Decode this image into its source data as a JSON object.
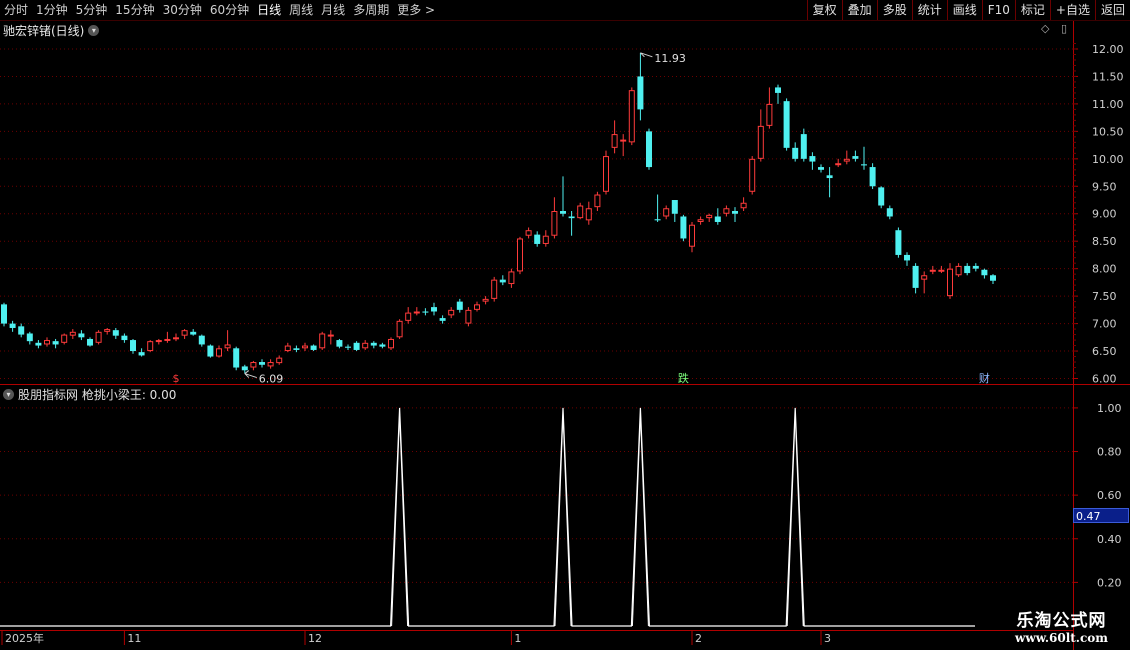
{
  "toolbar": {
    "tabs": [
      "分时",
      "1分钟",
      "5分钟",
      "15分钟",
      "30分钟",
      "60分钟",
      "日线",
      "周线",
      "月线",
      "多周期",
      "更多 >"
    ],
    "active_tab": "日线",
    "tools": [
      "复权",
      "叠加",
      "多股",
      "统计",
      "画线",
      "F10",
      "标记",
      "+自选",
      "返回"
    ]
  },
  "chart_title": {
    "name": "驰宏锌锗(日线)"
  },
  "indicator": {
    "title": "股朋指标网 枪挑小梁王: 0.00"
  },
  "cursor_value": "0.47",
  "brand": {
    "line1": "乐淘公式网",
    "line2": "www.60lt.com"
  },
  "colors": {
    "up": "#ff3b3b",
    "down": "#4ff0f0",
    "grid": "#6b0000",
    "bg": "#000000",
    "signal": "#ffffff"
  },
  "chart_data": [
    {
      "type": "candlestick",
      "ylim": [
        5.9,
        12.2
      ],
      "price_ticks": [
        "12.00",
        "11.50",
        "11.00",
        "10.50",
        "10.00",
        "9.50",
        "9.00",
        "8.50",
        "8.00",
        "7.50",
        "7.00",
        "6.50",
        "6.00"
      ],
      "annotations": {
        "high_label": "11.93",
        "low_label": "6.09"
      },
      "event_markers": [
        {
          "text": "$",
          "color": "#ff3b3b"
        },
        {
          "text": "跌",
          "color": "#7dff7d"
        },
        {
          "text": "财",
          "color": "#8fb8ff"
        }
      ],
      "x_labels": [
        "2025年",
        "11",
        "12",
        "1",
        "2",
        "3"
      ],
      "candles": [
        [
          7.35,
          7.0,
          7.38,
          6.95
        ],
        [
          7.0,
          6.92,
          7.05,
          6.85
        ],
        [
          6.95,
          6.8,
          7.0,
          6.75
        ],
        [
          6.82,
          6.68,
          6.85,
          6.62
        ],
        [
          6.65,
          6.6,
          6.7,
          6.55
        ],
        [
          6.62,
          6.7,
          6.75,
          6.58
        ],
        [
          6.68,
          6.62,
          6.72,
          6.55
        ],
        [
          6.65,
          6.8,
          6.82,
          6.62
        ],
        [
          6.78,
          6.85,
          6.9,
          6.72
        ],
        [
          6.82,
          6.75,
          6.88,
          6.7
        ],
        [
          6.72,
          6.6,
          6.75,
          6.58
        ],
        [
          6.65,
          6.85,
          6.88,
          6.62
        ],
        [
          6.85,
          6.9,
          6.92,
          6.8
        ],
        [
          6.88,
          6.78,
          6.92,
          6.72
        ],
        [
          6.78,
          6.7,
          6.82,
          6.65
        ],
        [
          6.7,
          6.5,
          6.72,
          6.45
        ],
        [
          6.48,
          6.42,
          6.55,
          6.4
        ],
        [
          6.5,
          6.68,
          6.7,
          6.48
        ],
        [
          6.68,
          6.7,
          6.72,
          6.62
        ],
        [
          6.7,
          6.72,
          6.85,
          6.65
        ],
        [
          6.72,
          6.75,
          6.82,
          6.68
        ],
        [
          6.78,
          6.88,
          6.9,
          6.72
        ],
        [
          6.85,
          6.8,
          6.9,
          6.78
        ],
        [
          6.78,
          6.62,
          6.8,
          6.58
        ],
        [
          6.6,
          6.4,
          6.62,
          6.38
        ],
        [
          6.4,
          6.55,
          6.6,
          6.38
        ],
        [
          6.55,
          6.62,
          6.88,
          6.5
        ],
        [
          6.55,
          6.2,
          6.58,
          6.15
        ],
        [
          6.22,
          6.15,
          6.25,
          6.09
        ],
        [
          6.2,
          6.3,
          6.32,
          6.15
        ],
        [
          6.3,
          6.25,
          6.35,
          6.2
        ],
        [
          6.22,
          6.3,
          6.35,
          6.18
        ],
        [
          6.28,
          6.38,
          6.42,
          6.25
        ],
        [
          6.5,
          6.6,
          6.65,
          6.48
        ],
        [
          6.55,
          6.52,
          6.6,
          6.48
        ],
        [
          6.55,
          6.6,
          6.65,
          6.5
        ],
        [
          6.6,
          6.52,
          6.62,
          6.5
        ],
        [
          6.55,
          6.82,
          6.85,
          6.52
        ],
        [
          6.78,
          6.8,
          6.88,
          6.62
        ],
        [
          6.7,
          6.58,
          6.72,
          6.55
        ],
        [
          6.58,
          6.56,
          6.62,
          6.52
        ],
        [
          6.65,
          6.52,
          6.68,
          6.5
        ],
        [
          6.55,
          6.65,
          6.7,
          6.52
        ],
        [
          6.65,
          6.6,
          6.68,
          6.55
        ],
        [
          6.62,
          6.58,
          6.65,
          6.55
        ],
        [
          6.55,
          6.72,
          6.75,
          6.52
        ],
        [
          6.75,
          7.05,
          7.08,
          6.72
        ],
        [
          7.05,
          7.2,
          7.3,
          7.0
        ],
        [
          7.22,
          7.22,
          7.3,
          7.15
        ],
        [
          7.22,
          7.2,
          7.28,
          7.15
        ],
        [
          7.3,
          7.22,
          7.38,
          7.15
        ],
        [
          7.1,
          7.05,
          7.15,
          7.0
        ],
        [
          7.15,
          7.25,
          7.3,
          7.1
        ],
        [
          7.4,
          7.25,
          7.45,
          7.2
        ],
        [
          7.0,
          7.25,
          7.3,
          6.95
        ],
        [
          7.25,
          7.35,
          7.4,
          7.22
        ],
        [
          7.4,
          7.45,
          7.5,
          7.35
        ],
        [
          7.45,
          7.8,
          7.85,
          7.4
        ],
        [
          7.8,
          7.75,
          7.88,
          7.7
        ],
        [
          7.72,
          7.95,
          8.0,
          7.65
        ],
        [
          7.95,
          8.55,
          8.58,
          7.9
        ],
        [
          8.6,
          8.7,
          8.75,
          8.55
        ],
        [
          8.62,
          8.45,
          8.68,
          8.4
        ],
        [
          8.45,
          8.6,
          8.7,
          8.4
        ],
        [
          8.6,
          9.05,
          9.3,
          8.55
        ],
        [
          9.05,
          9.0,
          9.68,
          8.95
        ],
        [
          8.95,
          8.92,
          9.05,
          8.6
        ],
        [
          8.92,
          9.15,
          9.2,
          8.9
        ],
        [
          8.88,
          9.1,
          9.22,
          8.8
        ],
        [
          9.12,
          9.35,
          9.4,
          9.05
        ],
        [
          9.4,
          10.05,
          10.15,
          9.35
        ],
        [
          10.2,
          10.45,
          10.7,
          10.1
        ],
        [
          10.35,
          10.35,
          10.45,
          10.05
        ],
        [
          10.3,
          11.25,
          11.3,
          10.25
        ],
        [
          11.5,
          10.9,
          11.93,
          10.7
        ],
        [
          10.5,
          9.85,
          10.55,
          9.8
        ],
        [
          8.9,
          8.88,
          9.35,
          8.85
        ],
        [
          8.95,
          9.1,
          9.15,
          8.9
        ],
        [
          9.25,
          9.0,
          9.25,
          8.85
        ],
        [
          8.95,
          8.55,
          8.98,
          8.5
        ],
        [
          8.4,
          8.8,
          8.85,
          8.3
        ],
        [
          8.85,
          8.9,
          8.95,
          8.8
        ],
        [
          8.92,
          8.98,
          9.0,
          8.85
        ],
        [
          8.95,
          8.85,
          9.1,
          8.8
        ],
        [
          9.0,
          9.1,
          9.15,
          8.95
        ],
        [
          9.05,
          9.0,
          9.12,
          8.85
        ],
        [
          9.1,
          9.2,
          9.3,
          9.05
        ],
        [
          9.4,
          10.0,
          10.05,
          9.35
        ],
        [
          10.0,
          10.6,
          10.9,
          9.95
        ],
        [
          10.6,
          11.0,
          11.3,
          10.55
        ],
        [
          11.3,
          11.2,
          11.35,
          11.0
        ],
        [
          11.05,
          10.2,
          11.1,
          10.15
        ],
        [
          10.2,
          10.0,
          10.3,
          9.95
        ],
        [
          10.45,
          10.0,
          10.55,
          9.95
        ],
        [
          10.05,
          9.95,
          10.12,
          9.8
        ],
        [
          9.85,
          9.8,
          9.9,
          9.75
        ],
        [
          9.7,
          9.65,
          9.85,
          9.3
        ],
        [
          9.9,
          9.92,
          10.0,
          9.85
        ],
        [
          9.95,
          10.0,
          10.15,
          9.9
        ],
        [
          10.05,
          10.0,
          10.15,
          9.95
        ],
        [
          9.9,
          9.88,
          10.22,
          9.8
        ],
        [
          9.85,
          9.5,
          9.92,
          9.45
        ],
        [
          9.48,
          9.15,
          9.5,
          9.1
        ],
        [
          9.1,
          8.95,
          9.15,
          8.9
        ],
        [
          8.7,
          8.25,
          8.75,
          8.2
        ],
        [
          8.25,
          8.15,
          8.3,
          8.05
        ],
        [
          8.05,
          7.65,
          8.1,
          7.55
        ],
        [
          7.8,
          7.88,
          7.95,
          7.55
        ],
        [
          7.98,
          7.98,
          8.05,
          7.9
        ],
        [
          7.98,
          7.98,
          8.05,
          7.92
        ],
        [
          7.5,
          8.0,
          8.1,
          7.45
        ],
        [
          7.88,
          8.05,
          8.1,
          7.85
        ],
        [
          8.05,
          7.92,
          8.1,
          7.88
        ],
        [
          8.05,
          8.0,
          8.1,
          7.95
        ],
        [
          7.98,
          7.88,
          8.0,
          7.82
        ],
        [
          7.88,
          7.78,
          7.9,
          7.72
        ]
      ]
    },
    {
      "type": "line",
      "name": "枪挑小梁王",
      "ylim": [
        0,
        1.05
      ],
      "value_ticks": [
        "1.00",
        "0.80",
        "0.60",
        "0.40",
        "0.20"
      ],
      "spike_candle_indexes": [
        46,
        65,
        74,
        92
      ],
      "baseline": 0.0,
      "peak": 1.0
    }
  ]
}
